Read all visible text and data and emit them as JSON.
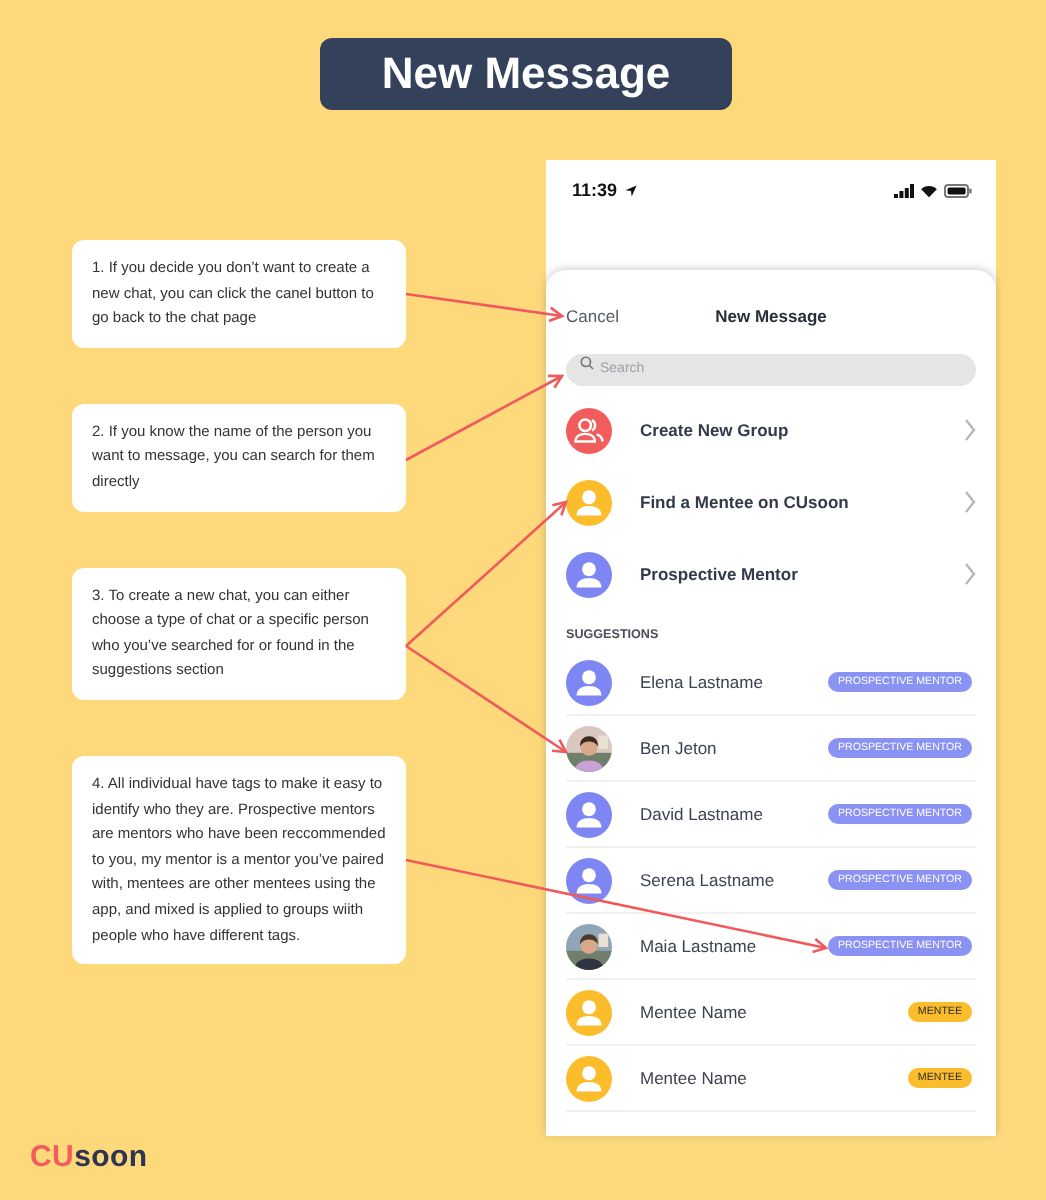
{
  "title": "New Message",
  "notes": [
    "1. If you decide you don’t want to create a new chat, you can click the canel button to go back to the chat page",
    "2. If you know the name of the person you want to message, you can search for them directly",
    "3. To create a new chat, you can either choose a type of chat or a specific person who you’ve searched for or found in the suggestions section",
    "4. All individual have tags to make it easy to identify who they are. Prospective mentors are mentors who have been reccommended to you, my mentor is a mentor you’ve paired with, mentees are other mentees using the app, and mixed is applied to groups wiith people who have different tags."
  ],
  "phone": {
    "status_bar": {
      "time": "11:39"
    },
    "sheet": {
      "cancel": "Cancel",
      "title": "New Message",
      "search": {
        "placeholder": "Search"
      },
      "options": [
        {
          "label": "Create New Group",
          "icon": {
            "kind": "group",
            "color": "#f25c5c"
          }
        },
        {
          "label": "Find a Mentee on CUsoon",
          "icon": {
            "kind": "person",
            "color": "#fbbd2c"
          }
        },
        {
          "label": "Prospective Mentor",
          "icon": {
            "kind": "person",
            "color": "#7d86f2"
          }
        }
      ],
      "section_label": "SUGGESTIONS",
      "suggestions": [
        {
          "name": "Elena Lastname",
          "avatar": {
            "kind": "person",
            "color": "#7d86f2"
          },
          "tag": {
            "kind": "mentor",
            "label": "PROSPECTIVE MENTOR"
          }
        },
        {
          "name": "Ben Jeton",
          "tag": {
            "kind": "mentor",
            "label": "PROSPECTIVE MENTOR"
          }
        },
        {
          "name": "David Lastname",
          "avatar": {
            "kind": "person",
            "color": "#7d86f2"
          },
          "tag": {
            "kind": "mentor",
            "label": "PROSPECTIVE MENTOR"
          }
        },
        {
          "name": "Serena Lastname",
          "avatar": {
            "kind": "person",
            "color": "#7d86f2"
          },
          "tag": {
            "kind": "mentor",
            "label": "PROSPECTIVE MENTOR"
          }
        },
        {
          "name": "Maia Lastname",
          "tag": {
            "kind": "mentor",
            "label": "PROSPECTIVE MENTOR"
          }
        },
        {
          "name": "Mentee Name",
          "avatar": {
            "kind": "person",
            "color": "#fbbd2c"
          },
          "tag": {
            "kind": "mentee",
            "label": "MENTEE"
          }
        },
        {
          "name": "Mentee Name",
          "avatar": {
            "kind": "person",
            "color": "#fbbd2c"
          },
          "tag": {
            "kind": "mentee",
            "label": "MENTEE"
          }
        }
      ]
    }
  },
  "logo": {
    "accent": "CU",
    "rest": "soon"
  }
}
